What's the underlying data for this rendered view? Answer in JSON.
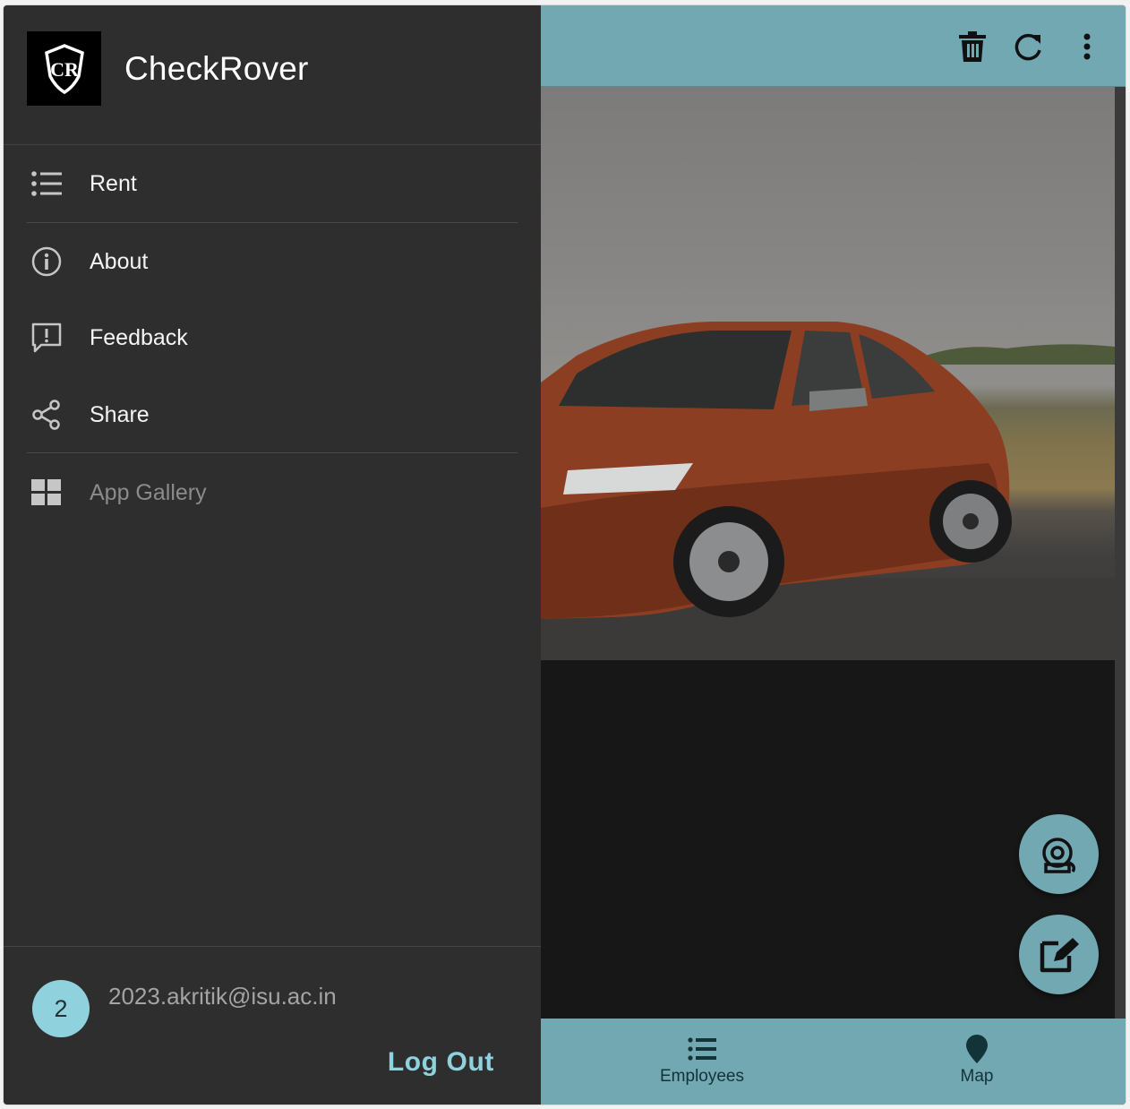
{
  "app": {
    "name": "CheckRover",
    "logo_text": "CR"
  },
  "drawer": {
    "items": [
      {
        "label": "Rent",
        "icon": "list-icon"
      },
      {
        "label": "About",
        "icon": "info-icon"
      },
      {
        "label": "Feedback",
        "icon": "feedback-icon"
      },
      {
        "label": "Share",
        "icon": "share-icon"
      },
      {
        "label": "App Gallery",
        "icon": "grid-icon",
        "disabled": true
      }
    ]
  },
  "account": {
    "avatar": "2",
    "email": "2023.akritik@isu.ac.in",
    "logout_label": "Log Out"
  },
  "toolbar": {
    "actions": [
      "trash-icon",
      "refresh-icon",
      "more-vert-icon"
    ]
  },
  "fabs": [
    "alarm-icon",
    "edit-icon"
  ],
  "bottom_nav": [
    {
      "label": "Employees",
      "icon": "list-icon"
    },
    {
      "label": "Map",
      "icon": "map-pin-icon"
    }
  ],
  "colors": {
    "primary": "#72a8b2",
    "drawer_bg": "#2e2e2e",
    "accent": "#8fd1dd",
    "content_bg": "#171717"
  }
}
